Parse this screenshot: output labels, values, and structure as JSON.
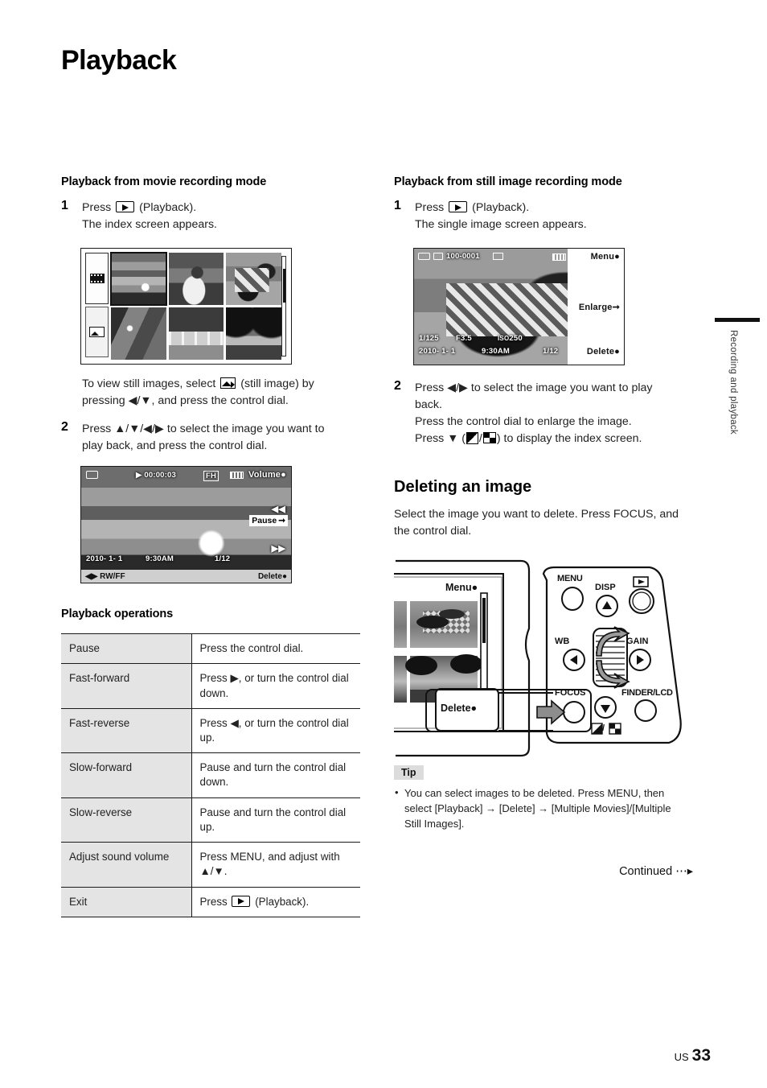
{
  "page": {
    "title": "Playback",
    "footer_locale": "US",
    "footer_page": "33",
    "side_tab": "Recording and playback",
    "continued": "Continued"
  },
  "left_column": {
    "section_title": "Playback from movie recording mode",
    "step1": {
      "number": "1",
      "line1_before": "Press",
      "line1_after": "(Playback).",
      "line2": "The index screen appears."
    },
    "note": {
      "line1_before": "To view still images, select",
      "line1_after": "(still image) by",
      "line2": "pressing ◀/▼, and press the control dial."
    },
    "step2": {
      "number": "2",
      "line1": "Press ▲/▼/◀/▶ to select the image you want to",
      "line2": "play back, and press the control dial."
    },
    "index_screen": {
      "side_icons": [
        "movie-film-icon",
        "still-image-icon"
      ],
      "thumbnails": [
        "sunset",
        "player",
        "race-car",
        "train",
        "hurdles",
        "trees"
      ],
      "selected_thumbnail_index": 0
    },
    "movie_screen": {
      "rec_mode_icon": "memory-card-icon",
      "play_icon": "▶",
      "timecode": "00:00:03",
      "quality": "FH",
      "battery": "battery-icon",
      "volume_label": "Volume",
      "pause_label": "Pause",
      "rewind_icon": "◀◀",
      "forward_icon": "▶▶",
      "date": "2010- 1- 1",
      "time": "9:30AM",
      "counter": "1/12",
      "bottom_left": "RW/FF",
      "bottom_left_icon": "◀▶",
      "delete_label": "Delete"
    },
    "operations_title": "Playback operations",
    "operations_table": {
      "rows": [
        {
          "action": "Pause",
          "instruction": "Press the control dial."
        },
        {
          "action": "Fast-forward",
          "instruction": "Press ▶, or turn the control dial down."
        },
        {
          "action": "Fast-reverse",
          "instruction": "Press ◀, or turn the control dial up."
        },
        {
          "action": "Slow-forward",
          "instruction": "Pause and turn the control dial down."
        },
        {
          "action": "Slow-reverse",
          "instruction": "Pause and turn the control dial up."
        },
        {
          "action": "Adjust sound volume",
          "instruction": "Press MENU, and adjust with ▲/▼."
        },
        {
          "action": "Exit",
          "instruction_before": "Press",
          "instruction_after": "(Playback)."
        }
      ]
    }
  },
  "right_column": {
    "section_title": "Playback from still image recording mode",
    "step1": {
      "number": "1",
      "line1_before": "Press",
      "line1_after": "(Playback).",
      "line2": "The single image screen appears."
    },
    "still_screen": {
      "card_icon": "memory-card-icon",
      "folder_icon": "folder-icon",
      "file_number": "100-0001",
      "protect_icon": "image-size-icon",
      "battery": "battery-icon",
      "menu_label": "Menu",
      "enlarge_label": "Enlarge",
      "shutter": "1/125",
      "aperture": "F3.5",
      "iso_prefix": "ISO",
      "iso": "250",
      "date": "2010- 1- 1",
      "time": "9:30AM",
      "counter": "1/12",
      "delete_label": "Delete"
    },
    "step2": {
      "number": "2",
      "line1": "Press ◀/▶ to select the image you want to play",
      "line2": "back.",
      "line3": "Press the control dial to enlarge the image.",
      "line4_before": "Press ▼ (",
      "line4_mid": "/",
      "line4_after": ") to display the index screen."
    },
    "delete_section": {
      "title": "Deleting an image",
      "body": "Select the image you want to delete. Press FOCUS, and the control dial."
    },
    "camera_diagram": {
      "screen_menu_label": "Menu",
      "screen_delete_label": "Delete",
      "buttons": [
        {
          "label": "MENU",
          "name": "menu-button"
        },
        {
          "label": "DISP",
          "name": "disp-up-button"
        },
        {
          "label": "",
          "name": "playback-button"
        },
        {
          "label": "WB",
          "name": "wb-left-button"
        },
        {
          "label": "GAIN",
          "name": "gain-right-button"
        },
        {
          "label": "FOCUS",
          "name": "focus-button"
        },
        {
          "label": "FINDER/LCD",
          "name": "finder-lcd-button"
        }
      ],
      "down_button_caption": "/",
      "thumbnails": [
        "race-car",
        "trees"
      ]
    },
    "tip": {
      "label": "Tip",
      "text": "You can select images to be deleted. Press MENU, then select [Playback] → [Delete] → [Multiple Movies]/[Multiple Still Images]."
    }
  }
}
